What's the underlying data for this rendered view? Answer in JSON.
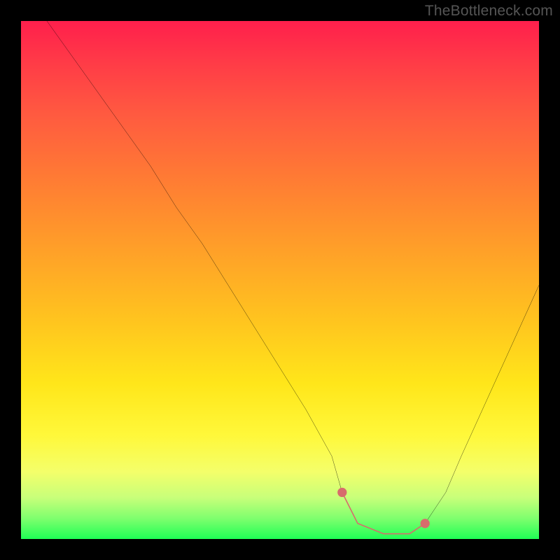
{
  "watermark": "TheBottleneck.com",
  "chart_data": {
    "type": "line",
    "title": "",
    "xlabel": "",
    "ylabel": "",
    "xlim": [
      0,
      100
    ],
    "ylim": [
      0,
      100
    ],
    "series": [
      {
        "name": "bottleneck-curve",
        "x": [
          5,
          10,
          15,
          20,
          25,
          30,
          35,
          40,
          45,
          50,
          55,
          60,
          62,
          65,
          70,
          75,
          78,
          82,
          85,
          90,
          95,
          100
        ],
        "y": [
          100,
          93,
          86,
          79,
          72,
          64,
          57,
          49,
          41,
          33,
          25,
          16,
          9,
          3,
          1,
          1,
          3,
          9,
          16,
          27,
          38,
          49
        ]
      },
      {
        "name": "highlight-segment",
        "x": [
          62,
          65,
          70,
          75,
          78
        ],
        "y": [
          9,
          3,
          1,
          1,
          3
        ]
      }
    ],
    "highlight_color": "#d76c6c",
    "curve_color": "#000000",
    "gradient_stops": [
      {
        "pos": 0.0,
        "color": "#ff1f4c"
      },
      {
        "pos": 0.08,
        "color": "#ff3b47"
      },
      {
        "pos": 0.18,
        "color": "#ff5a40"
      },
      {
        "pos": 0.3,
        "color": "#ff7a34"
      },
      {
        "pos": 0.42,
        "color": "#ff9a2a"
      },
      {
        "pos": 0.57,
        "color": "#ffc21f"
      },
      {
        "pos": 0.7,
        "color": "#ffe61a"
      },
      {
        "pos": 0.8,
        "color": "#fff83a"
      },
      {
        "pos": 0.87,
        "color": "#f4ff6a"
      },
      {
        "pos": 0.92,
        "color": "#c8ff7a"
      },
      {
        "pos": 0.96,
        "color": "#7fff6e"
      },
      {
        "pos": 1.0,
        "color": "#1fff55"
      }
    ]
  }
}
